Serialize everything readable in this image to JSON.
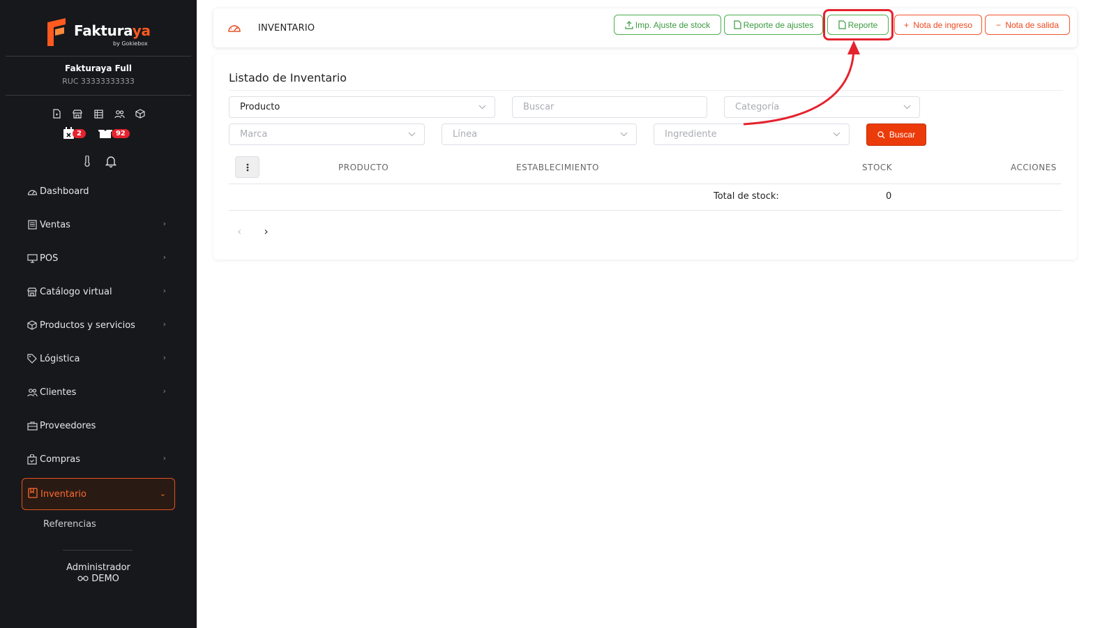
{
  "sidebar": {
    "brand": {
      "name_main": "Fakturaya",
      "name_part1": "Faktura",
      "name_part2": "ya",
      "sub": "by Gokiebox"
    },
    "company": "Fakturaya Full",
    "ruc": "RUC 33333333333",
    "quick_icons": [
      "file-icon",
      "store-icon",
      "table-icon",
      "users-icon",
      "box-icon"
    ],
    "badges": {
      "calendar_count": "2",
      "boxes_count": "92"
    },
    "items": [
      {
        "label": "Dashboard",
        "icon": "dashboard-icon",
        "has_chevron": false
      },
      {
        "label": "Ventas",
        "icon": "ventas-icon",
        "has_chevron": true
      },
      {
        "label": "POS",
        "icon": "monitor-icon",
        "has_chevron": true
      },
      {
        "label": "Catálogo virtual",
        "icon": "store-icon",
        "has_chevron": true
      },
      {
        "label": "Productos y servicios",
        "icon": "box-icon",
        "has_chevron": true
      },
      {
        "label": "Lógistica",
        "icon": "tag-icon",
        "has_chevron": true
      },
      {
        "label": "Clientes",
        "icon": "users-icon",
        "has_chevron": true
      },
      {
        "label": "Proveedores",
        "icon": "briefcase-icon",
        "has_chevron": false
      },
      {
        "label": "Compras",
        "icon": "bag-icon",
        "has_chevron": true
      }
    ],
    "active_item": {
      "label": "Inventario",
      "icon": "inventory-icon"
    },
    "sub_item": "Referencias",
    "user": {
      "role": "Administrador",
      "name": "DEMO"
    }
  },
  "header": {
    "title": "INVENTARIO",
    "buttons": {
      "imp_ajuste": "Imp. Ajuste de stock",
      "reporte_ajustes": "Reporte de ajustes",
      "reporte": "Reporte",
      "nota_ingreso": "Nota de ingreso",
      "nota_salida": "Nota de salida"
    }
  },
  "main": {
    "title": "Listado de Inventario",
    "filters": {
      "producto_value": "Producto",
      "buscar_placeholder": "Buscar",
      "categoria_placeholder": "Categoría",
      "marca_placeholder": "Marca",
      "linea_placeholder": "Línea",
      "ingrediente_placeholder": "Ingrediente",
      "search_button": "Buscar"
    },
    "table": {
      "columns": [
        "PRODUCTO",
        "ESTABLECIMIENTO",
        "STOCK",
        "ACCIONES"
      ],
      "total_label": "Total de stock:",
      "total_value": "0"
    }
  },
  "colors": {
    "accent": "#ec3b0a",
    "green": "#3a9a3f",
    "highlight": "#e5232e",
    "sidebar_bg": "#17181c"
  }
}
